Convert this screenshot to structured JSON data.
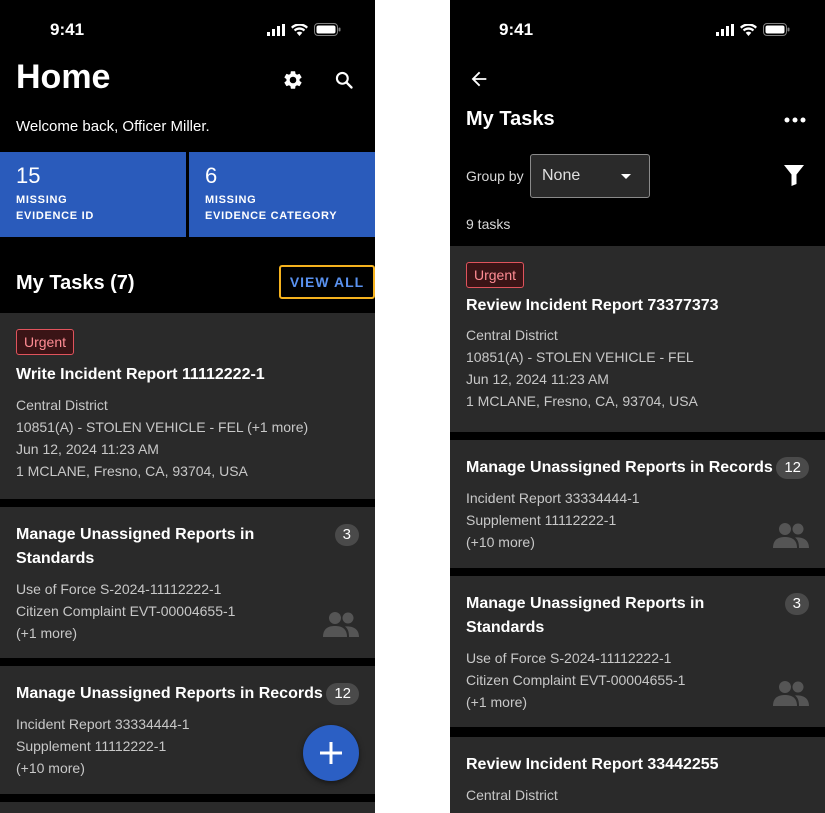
{
  "left_screen": {
    "status": {
      "time": "9:41"
    },
    "header": {
      "title": "Home",
      "welcome": "Welcome back, Officer Miller."
    },
    "stats": [
      {
        "number": "15",
        "label_line1": "MISSING",
        "label_line2": "EVIDENCE ID"
      },
      {
        "number": "6",
        "label_line1": "MISSING",
        "label_line2": "EVIDENCE CATEGORY"
      }
    ],
    "tasks_section": {
      "heading": "My Tasks (7)",
      "view_all": "VIEW ALL"
    },
    "cards": [
      {
        "badge": "Urgent",
        "title": "Write Incident Report 11112222-1",
        "lines": [
          "Central District",
          "10851(A) - STOLEN VEHICLE - FEL (+1 more)",
          "Jun 12, 2024 11:23 AM",
          "1 MCLANE, Fresno, CA, 93704, USA"
        ]
      },
      {
        "title_line1": "Manage Unassigned Reports in",
        "title_line2": "Standards",
        "count": "3",
        "lines": [
          "Use of Force S-2024-11112222-1",
          "Citizen Complaint EVT-00004655-1",
          "(+1 more)"
        ]
      },
      {
        "title": "Manage Unassigned Reports in Records",
        "count": "12",
        "lines": [
          "Incident Report 33334444-1",
          "Supplement 11112222-1",
          "(+10 more)"
        ]
      }
    ],
    "fab_icon": "plus-icon"
  },
  "right_screen": {
    "status": {
      "time": "9:41"
    },
    "title": "My Tasks",
    "group_by": {
      "label": "Group by",
      "value": "None"
    },
    "task_count": "9 tasks",
    "cards": [
      {
        "badge": "Urgent",
        "title": "Review Incident Report 73377373",
        "lines": [
          "Central District",
          "10851(A) - STOLEN VEHICLE - FEL",
          "Jun 12, 2024 11:23 AM",
          "1 MCLANE, Fresno, CA, 93704, USA"
        ]
      },
      {
        "title": "Manage Unassigned Reports in Records",
        "count": "12",
        "lines": [
          "Incident Report 33334444-1",
          "Supplement 11112222-1",
          "(+10 more)"
        ]
      },
      {
        "title_line1": "Manage Unassigned Reports in",
        "title_line2": "Standards",
        "count": "3",
        "lines": [
          "Use of Force S-2024-11112222-1",
          "Citizen Complaint EVT-00004655-1",
          "(+1 more)"
        ]
      },
      {
        "title": "Review Incident Report 33442255",
        "lines": [
          "Central District"
        ]
      }
    ]
  },
  "colors": {
    "accent_blue": "#2a5bbb",
    "link_blue": "#5a92f0",
    "focus_outline": "#f5b21e",
    "urgent_red": "#e0535c",
    "card_bg": "#2a2a2a"
  }
}
